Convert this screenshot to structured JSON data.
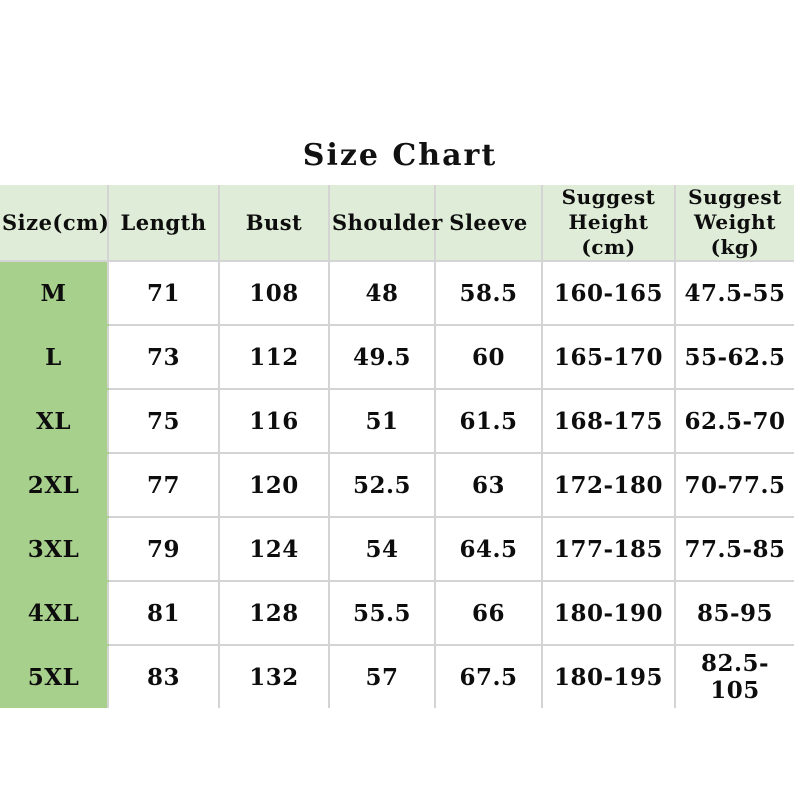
{
  "title": "Size Chart",
  "table": {
    "columns": [
      {
        "key": "size",
        "label": "Size(cm)",
        "lines": [
          "Size(cm)"
        ]
      },
      {
        "key": "length",
        "label": "Length",
        "lines": [
          "Length"
        ]
      },
      {
        "key": "bust",
        "label": "Bust",
        "lines": [
          "Bust"
        ]
      },
      {
        "key": "shoulder",
        "label": "Shoulder",
        "lines": [
          "Shoulder"
        ]
      },
      {
        "key": "sleeve",
        "label": "Sleeve",
        "lines": [
          "Sleeve"
        ]
      },
      {
        "key": "height",
        "label": "Suggest Height (cm)",
        "lines": [
          "Suggest",
          "Height (cm)"
        ]
      },
      {
        "key": "weight",
        "label": "Suggest Weight (kg)",
        "lines": [
          "Suggest",
          "Weight (kg)"
        ]
      }
    ],
    "rows": [
      {
        "size": "M",
        "length": "71",
        "bust": "108",
        "shoulder": "48",
        "sleeve": "58.5",
        "height": "160-165",
        "weight": "47.5-55"
      },
      {
        "size": "L",
        "length": "73",
        "bust": "112",
        "shoulder": "49.5",
        "sleeve": "60",
        "height": "165-170",
        "weight": "55-62.5"
      },
      {
        "size": "XL",
        "length": "75",
        "bust": "116",
        "shoulder": "51",
        "sleeve": "61.5",
        "height": "168-175",
        "weight": "62.5-70"
      },
      {
        "size": "2XL",
        "length": "77",
        "bust": "120",
        "shoulder": "52.5",
        "sleeve": "63",
        "height": "172-180",
        "weight": "70-77.5"
      },
      {
        "size": "3XL",
        "length": "79",
        "bust": "124",
        "shoulder": "54",
        "sleeve": "64.5",
        "height": "177-185",
        "weight": "77.5-85"
      },
      {
        "size": "4XL",
        "length": "81",
        "bust": "128",
        "shoulder": "55.5",
        "sleeve": "66",
        "height": "180-190",
        "weight": "85-95"
      },
      {
        "size": "5XL",
        "length": "83",
        "bust": "132",
        "shoulder": "57",
        "sleeve": "67.5",
        "height": "180-195",
        "weight": "82.5-105"
      }
    ]
  },
  "colors": {
    "header_background": "#dfecd8",
    "size_column_background": "#a7d08c",
    "grid_line": "#d4d4d4",
    "text": "#0d0d0d",
    "page_background": "#ffffff"
  }
}
